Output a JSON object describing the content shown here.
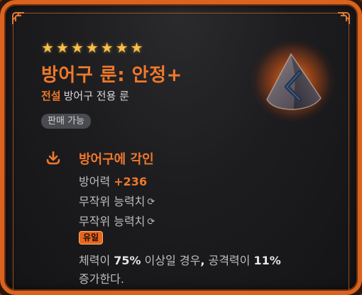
{
  "item": {
    "stars": [
      "★",
      "★",
      "★",
      "★",
      "★",
      "★",
      "★"
    ],
    "name": "방어구 룬: 안정+",
    "grade": "전설",
    "category": "방어구 전용 룬",
    "sell_status": "판매 가능",
    "icon": "triangle-rune-icon"
  },
  "engrave": {
    "title": "방어구에 각인",
    "icon": "download-arrow-icon",
    "defense_label": "방어력",
    "defense_value": "+236",
    "random_stats": [
      {
        "label": "무작위 능력치",
        "icon": "refresh-icon",
        "glyph": "⟳"
      },
      {
        "label": "무작위 능력치",
        "icon": "refresh-icon",
        "glyph": "⟳"
      }
    ],
    "unique_badge": "유일",
    "effect": {
      "part1": "체력이 ",
      "hp_value": "75%",
      "part2": " 이상일 경우",
      "comma": ",",
      "part3": " 공격력이 ",
      "atk_value": "11%",
      "line2": "증가한다."
    }
  },
  "colors": {
    "accent": "#f0782a",
    "border": "#d9631f",
    "star": "#f6c04a",
    "background": "#1d1d20"
  }
}
